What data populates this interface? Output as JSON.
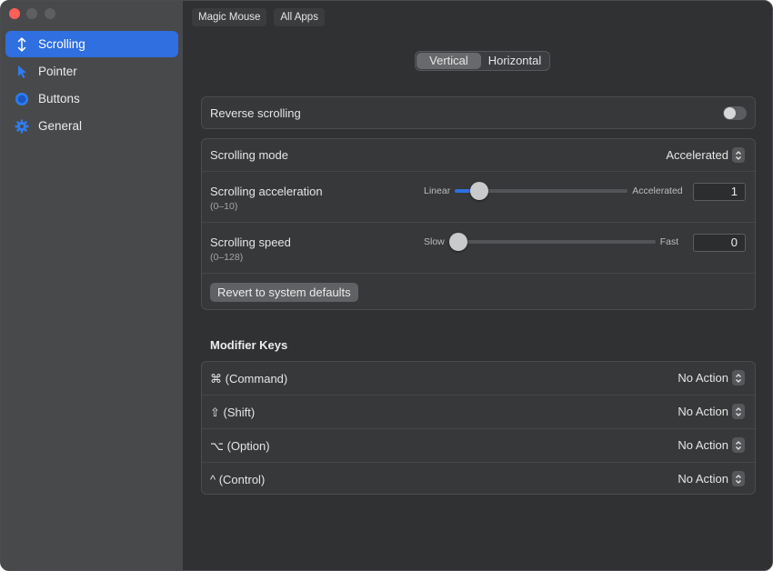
{
  "sidebar": {
    "items": [
      {
        "label": "Scrolling",
        "icon": "updown-arrow-icon",
        "active": true
      },
      {
        "label": "Pointer",
        "icon": "cursor-arrow-icon",
        "active": false
      },
      {
        "label": "Buttons",
        "icon": "circle-icon",
        "active": false
      },
      {
        "label": "General",
        "icon": "gear-icon",
        "active": false
      }
    ]
  },
  "header": {
    "device_label": "Magic Mouse",
    "apps_label": "All Apps"
  },
  "direction": {
    "options": [
      "Vertical",
      "Horizontal"
    ],
    "selected": "Vertical"
  },
  "reverse_scrolling": {
    "label": "Reverse scrolling",
    "enabled": false
  },
  "scroll_settings": {
    "mode": {
      "label": "Scrolling mode",
      "value": "Accelerated"
    },
    "acceleration": {
      "label": "Scrolling acceleration",
      "range": "(0–10)",
      "min_label": "Linear",
      "max_label": "Accelerated",
      "value": "1",
      "min": 0,
      "max": 10,
      "level": 1
    },
    "speed": {
      "label": "Scrolling speed",
      "range": "(0–128)",
      "min_label": "Slow",
      "max_label": "Fast",
      "value": "0",
      "min": 0,
      "max": 128,
      "level": 0
    },
    "revert_label": "Revert to system defaults"
  },
  "modifier_keys": {
    "title": "Modifier Keys",
    "items": [
      {
        "label": "⌘ (Command)",
        "value": "No Action"
      },
      {
        "label": "⇧ (Shift)",
        "value": "No Action"
      },
      {
        "label": "⌥ (Option)",
        "value": "No Action"
      },
      {
        "label": "^ (Control)",
        "value": "No Action"
      }
    ]
  },
  "colors": {
    "accent": "#2f6fe0",
    "close": "#fe5f57"
  }
}
